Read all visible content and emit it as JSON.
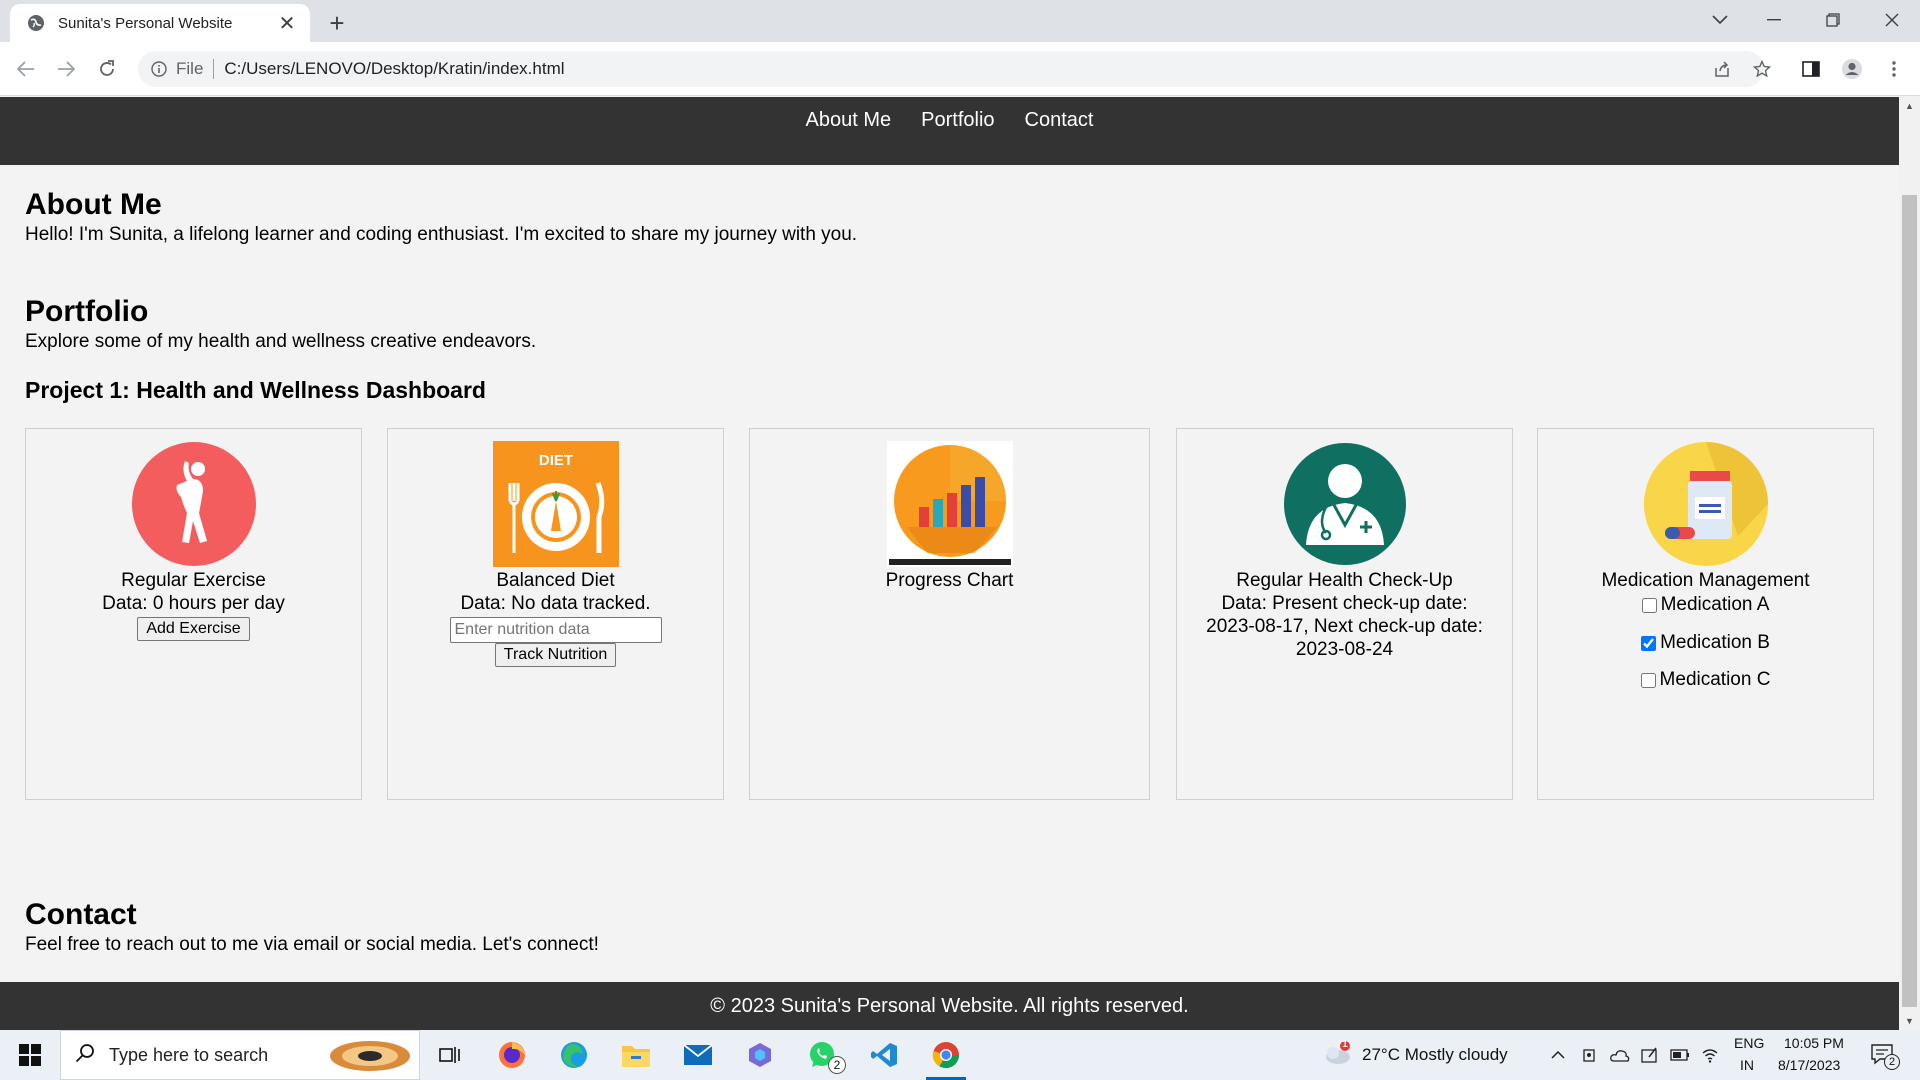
{
  "browser": {
    "tab_title": "Sunita's Personal Website",
    "omnibox_scheme": "File",
    "omnibox_url": "C:/Users/LENOVO/Desktop/Kratin/index.html",
    "minimize_glyph": "—",
    "maximize_glyph": "❐",
    "close_glyph": "✕",
    "new_tab_glyph": "+"
  },
  "site": {
    "nav": {
      "about": "About Me",
      "portfolio": "Portfolio",
      "contact": "Contact"
    },
    "about": {
      "heading": "About Me",
      "text": "Hello! I'm Sunita, a lifelong learner and coding enthusiast. I'm excited to share my journey with you."
    },
    "portfolio": {
      "heading": "Portfolio",
      "text": "Explore some of my health and wellness creative endeavors.",
      "project_title": "Project 1: Health and Wellness Dashboard"
    },
    "cards": {
      "exercise": {
        "title": "Regular Exercise",
        "data": "Data: 0 hours per day",
        "button": "Add Exercise"
      },
      "diet": {
        "title": "Balanced Diet",
        "data": "Data: No data tracked.",
        "input_placeholder": "Enter nutrition data",
        "button": "Track Nutrition",
        "image_label": "DIET"
      },
      "progress": {
        "title": "Progress Chart"
      },
      "checkup": {
        "title": "Regular Health Check-Up",
        "data": "Data: Present check-up date: 2023-08-17, Next check-up date: 2023-08-24"
      },
      "medication": {
        "title": "Medication Management",
        "items": [
          {
            "label": "Medication A",
            "checked": false
          },
          {
            "label": "Medication B",
            "checked": true
          },
          {
            "label": "Medication C",
            "checked": false
          }
        ]
      }
    },
    "contact": {
      "heading": "Contact",
      "text": "Feel free to reach out to me via email or social media. Let's connect!"
    },
    "footer": "© 2023 Sunita's Personal Website. All rights reserved."
  },
  "taskbar": {
    "search_placeholder": "Type here to search",
    "whatsapp_badge": "2",
    "weather_badge": "1",
    "weather": "27°C  Mostly cloudy",
    "lang_top": "ENG",
    "lang_bottom": "IN",
    "time": "10:05 PM",
    "date": "8/17/2023",
    "notification_count": "2"
  },
  "colors": {
    "nav_bg": "#333333",
    "page_bg": "#f3f3f3",
    "exercise_red": "#f45d5d",
    "diet_orange": "#f7941d",
    "checkup_teal": "#0f6f61",
    "medication_yellow": "#f9d548"
  }
}
